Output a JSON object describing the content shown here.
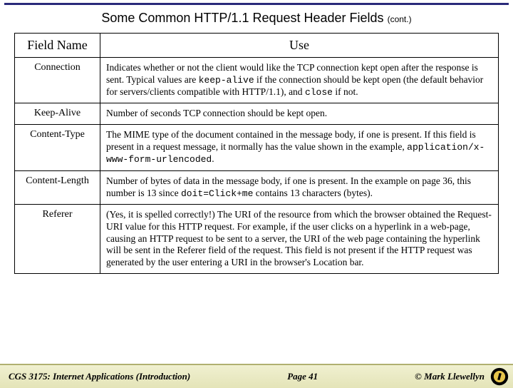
{
  "title": "Some Common HTTP/1.1 Request Header Fields",
  "title_cont": "(cont.)",
  "columns": {
    "field": "Field Name",
    "use": "Use"
  },
  "rows": [
    {
      "field": "Connection",
      "use_html": "Indicates whether or not the client would like the TCP connection kept open after the response is sent.  Typical values are <span class=\"mono\">keep-alive</span> if the connection should be kept open (the default behavior for servers/clients compatible with HTTP/1.1), and <span class=\"mono\">close</span> if not."
    },
    {
      "field": "Keep-Alive",
      "use_html": "Number of seconds TCP connection should be kept open."
    },
    {
      "field": "Content-Type",
      "use_html": "The MIME type of the document contained in the message body, if one is present.  If this field is present in a request message, it normally has the value shown in the example, <span class=\"mono\">application/x-www-form-urlencoded</span>."
    },
    {
      "field": "Content-Length",
      "use_html": "Number of bytes of data in the message body, if one is present.  In the example on page 36, this number is 13 since <span class=\"mono\">doit=Click+me</span> contains 13 characters (bytes)."
    },
    {
      "field": "Referer",
      "use_html": "(Yes, it is spelled correctly!) The URI of the resource from which the browser obtained the Request-URI value for this HTTP request.  For example, if the user clicks on a hyperlink in a web-page, causing an HTTP request to be sent to a server, the URI of the web page containing the hyperlink will be sent in the Referer field of the request.  This field is not present if the HTTP request was generated by the user entering a URI in the browser's Location bar."
    }
  ],
  "footer": {
    "course": "CGS 3175: Internet Applications (Introduction)",
    "page": "Page 41",
    "copyright": "© Mark Llewellyn"
  },
  "chart_data": {
    "type": "table",
    "title": "Some Common HTTP/1.1 Request Header Fields (cont.)",
    "columns": [
      "Field Name",
      "Use"
    ],
    "rows": [
      [
        "Connection",
        "Indicates whether or not the client would like the TCP connection kept open after the response is sent. Typical values are keep-alive if the connection should be kept open (the default behavior for servers/clients compatible with HTTP/1.1), and close if not."
      ],
      [
        "Keep-Alive",
        "Number of seconds TCP connection should be kept open."
      ],
      [
        "Content-Type",
        "The MIME type of the document contained in the message body, if one is present. If this field is present in a request message, it normally has the value shown in the example, application/x-www-form-urlencoded."
      ],
      [
        "Content-Length",
        "Number of bytes of data in the message body, if one is present. In the example on page 36, this number is 13 since doit=Click+me contains 13 characters (bytes)."
      ],
      [
        "Referer",
        "(Yes, it is spelled correctly!) The URI of the resource from which the browser obtained the Request-URI value for this HTTP request. For example, if the user clicks on a hyperlink in a web-page, causing an HTTP request to be sent to a server, the URI of the web page containing the hyperlink will be sent in the Referer field of the request. This field is not present if the HTTP request was generated by the user entering a URI in the browser's Location bar."
      ]
    ]
  }
}
